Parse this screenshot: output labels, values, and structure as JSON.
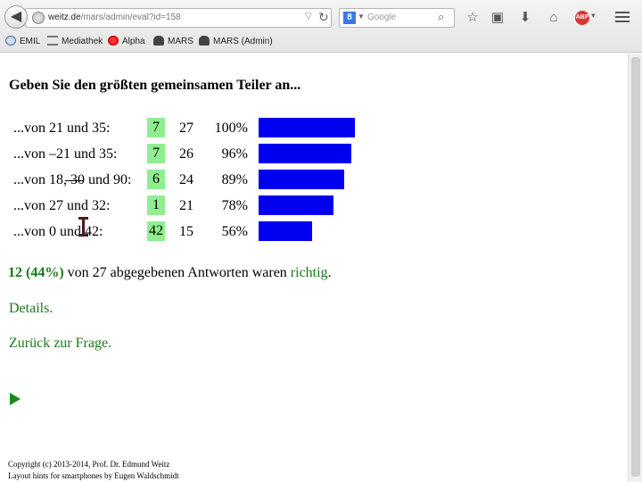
{
  "browser": {
    "url_host": "weitz.de",
    "url_path": "/mars/admin/eval?id=158",
    "search_placeholder": "Google",
    "engine_letter": "8",
    "abp_label": "ABP",
    "bookmarks": [
      {
        "label": "EMIL",
        "icon": "globe-icon"
      },
      {
        "label": "Mediathek",
        "icon": "list-icon"
      },
      {
        "label": "Alpha",
        "icon": "gear-icon"
      },
      {
        "label": "MARS",
        "icon": "mars-icon"
      },
      {
        "label": "MARS (Admin)",
        "icon": "mars-icon"
      }
    ]
  },
  "page": {
    "question": "Geben Sie den größten gemeinsamen Teiler an...",
    "rows": [
      {
        "label": "...von 21 und 35:",
        "answer": "7",
        "count": "27",
        "percent": "100%",
        "share": 1.0
      },
      {
        "label_prefix": "...von ",
        "label_struck": "–",
        "label_rest": "21 und 35:",
        "answer": "7",
        "count": "26",
        "percent": "96%",
        "share": 0.96
      },
      {
        "label_prefix": "...von 18, ",
        "label_struck": "30",
        "label_rest": " und 90:",
        "answer": "6",
        "count": "24",
        "percent": "89%",
        "share": 0.89
      },
      {
        "label": "...von 27 und 32:",
        "answer": "1",
        "count": "21",
        "percent": "78%",
        "share": 0.78
      },
      {
        "label": "...von 0 und 42:",
        "answer": "42",
        "count": "15",
        "percent": "56%",
        "share": 0.56
      }
    ],
    "bar_color": "#0000ee",
    "answer_bg": "#90ee90",
    "summary": {
      "correct": "12 (44%)",
      "middle": " von 27 abgegebenen Antworten waren ",
      "word": "richtig",
      "end": "."
    },
    "details_link": "Details.",
    "back_link": "Zurück zur Frage.",
    "footer_line1": "Copyright (c) 2013-2014, Prof. Dr. Edmund Weitz",
    "footer_line2": "Layout hints for smartphones by Eugen Waldschmidt"
  }
}
